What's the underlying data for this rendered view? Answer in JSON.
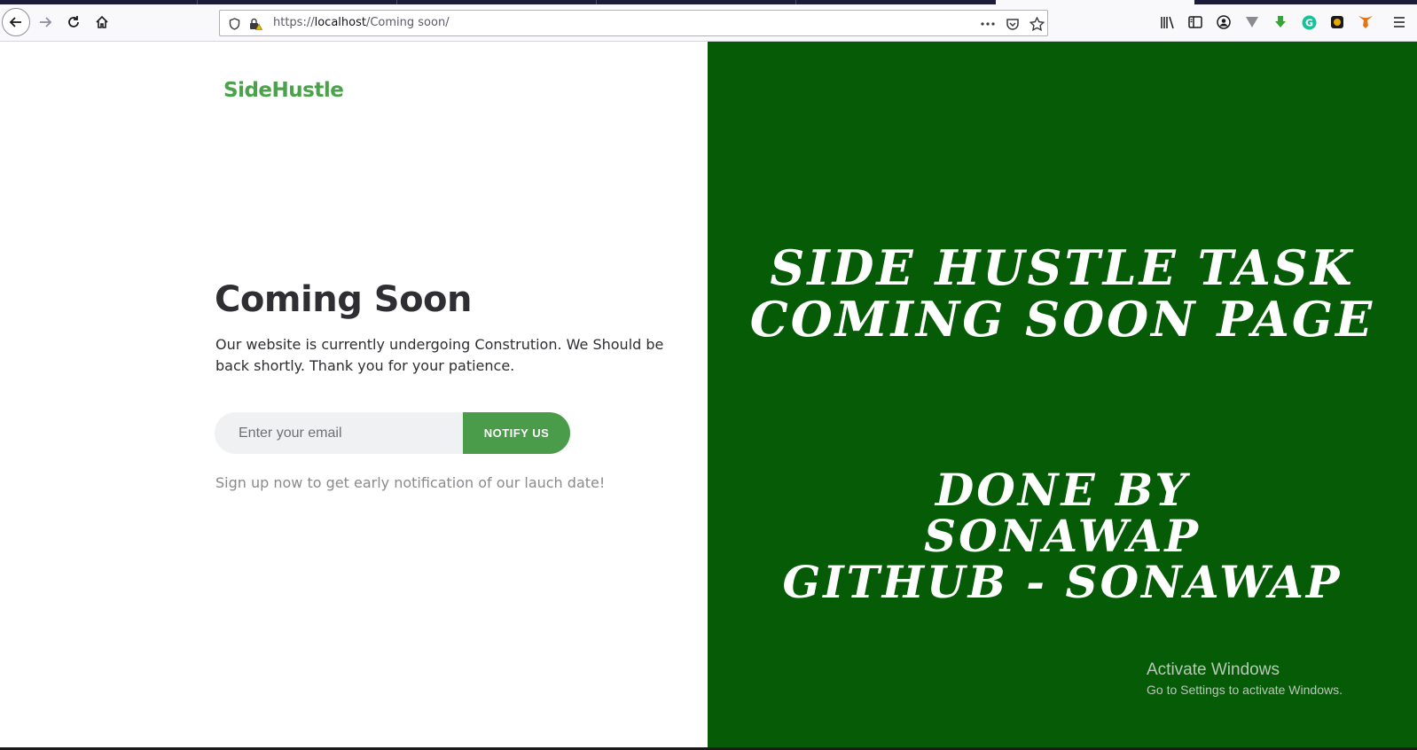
{
  "browser": {
    "url_prefix": "https://",
    "url_host": "localhost",
    "url_path": "/Coming soon/",
    "icons": [
      "back-icon",
      "forward-icon",
      "reload-icon",
      "home-icon",
      "shield-icon",
      "lock-warning-icon",
      "more-icon",
      "pocket-icon",
      "bookmark-star-icon",
      "library-icon",
      "sidebar-icon",
      "account-icon",
      "extension-icon",
      "download-extension-icon",
      "grammarly-icon",
      "extension-dark-icon",
      "metamask-icon",
      "menu-icon"
    ]
  },
  "page": {
    "logo": {
      "main": "SideHustle"
    },
    "title": "Coming Soon",
    "description": "Our website is currently undergoing Constrution. We Should be back shortly. Thank you for your patience.",
    "email_placeholder": "Enter your email",
    "notify_label": "NOTIFY US",
    "signup_note": "Sign up now to get early notification of our lauch date!",
    "banner": {
      "line1": "SIDE HUSTLE TASK",
      "line2": "COMING SOON PAGE",
      "line3": "DONE BY",
      "line4": "SONAWAP",
      "line5": "GITHUB - SONAWAP"
    },
    "watermark": {
      "title": "Activate Windows",
      "subtitle": "Go to Settings to activate Windows."
    }
  },
  "colors": {
    "brand_green": "#4aa24a",
    "panel_green": "#065c06",
    "button_green": "#4a9b4a"
  }
}
